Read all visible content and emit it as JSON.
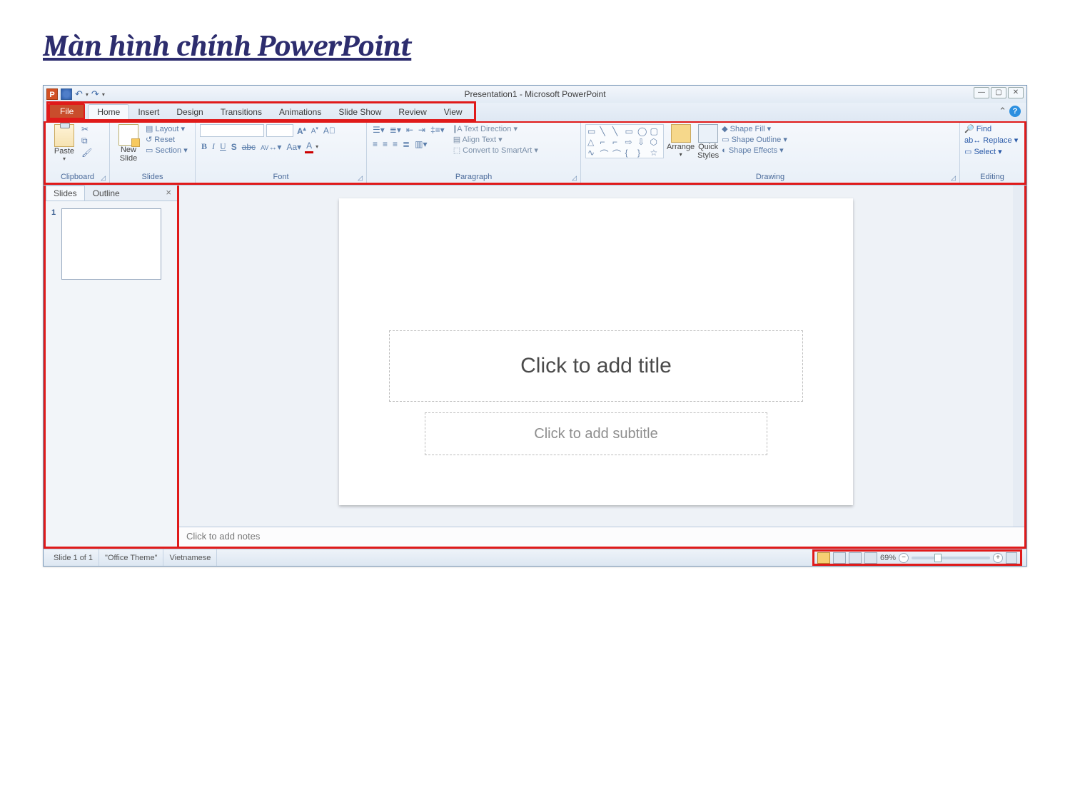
{
  "page_heading": "Màn hình chính PowerPoint",
  "window_title": "Presentation1  -  Microsoft PowerPoint",
  "ribbon": {
    "file_tab": "File",
    "tabs": [
      "Home",
      "Insert",
      "Design",
      "Transitions",
      "Animations",
      "Slide Show",
      "Review",
      "View"
    ],
    "active_tab_index": 0,
    "groups": {
      "clipboard": {
        "label": "Clipboard",
        "paste": "Paste"
      },
      "slides": {
        "label": "Slides",
        "new_slide": "New\nSlide",
        "layout": "Layout",
        "reset": "Reset",
        "section": "Section"
      },
      "font": {
        "label": "Font",
        "bold": "B",
        "italic": "I",
        "underline": "U",
        "shadow": "S",
        "strike": "abc",
        "spacing": "AV",
        "case": "Aa",
        "color": "A",
        "grow": "A",
        "shrink": "A",
        "clear": "Aa"
      },
      "paragraph": {
        "label": "Paragraph",
        "text_direction": "Text Direction",
        "align_text": "Align Text",
        "smartart": "Convert to SmartArt"
      },
      "drawing": {
        "label": "Drawing",
        "arrange": "Arrange",
        "quick_styles": "Quick\nStyles",
        "fill": "Shape Fill",
        "outline": "Shape Outline",
        "effects": "Shape Effects"
      },
      "editing": {
        "label": "Editing",
        "find": "Find",
        "replace": "Replace",
        "select": "Select"
      }
    }
  },
  "slide_panel": {
    "tab_slides": "Slides",
    "tab_outline": "Outline",
    "close": "×",
    "thumb_number": "1"
  },
  "canvas": {
    "title_placeholder": "Click to add title",
    "subtitle_placeholder": "Click to add subtitle"
  },
  "notes_placeholder": "Click to add notes",
  "statusbar": {
    "slide_counter": "Slide 1 of 1",
    "theme": "\"Office Theme\"",
    "language": "Vietnamese",
    "zoom": "69%"
  }
}
